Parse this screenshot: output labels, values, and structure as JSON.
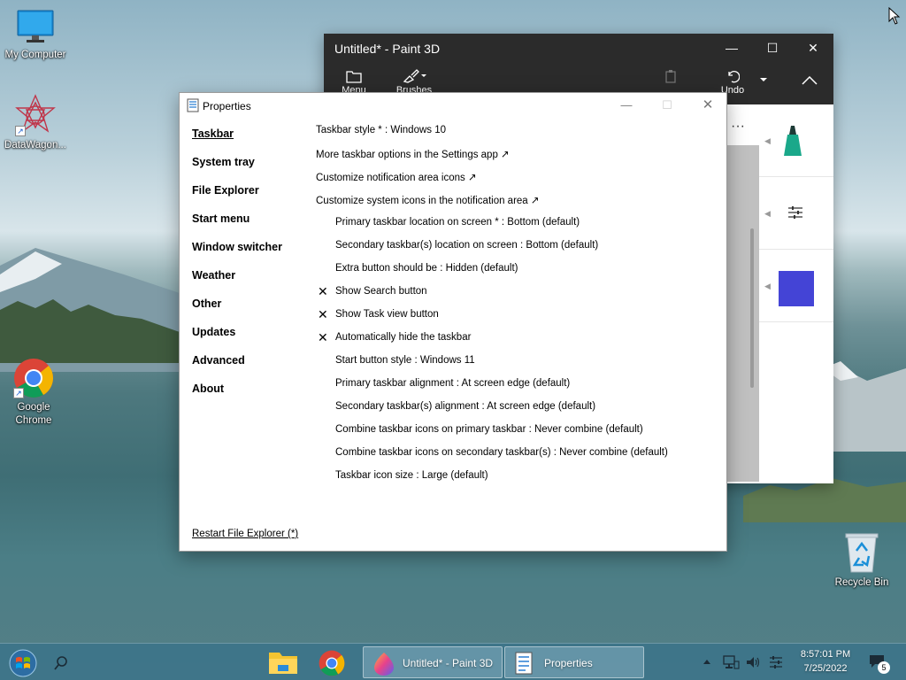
{
  "desktop": {
    "icons": [
      {
        "label": "My Computer"
      },
      {
        "label": "DataWagon..."
      },
      {
        "label": "Google Chrome"
      },
      {
        "label": "Recycle Bin"
      }
    ]
  },
  "paint": {
    "title": "Untitled* - Paint 3D",
    "toolbar": [
      {
        "label": "Menu",
        "icon": "folder-icon"
      },
      {
        "label": "Brushes",
        "icon": "brush-icon"
      },
      {
        "label": "",
        "icon": "paste-icon"
      },
      {
        "label": "Undo",
        "icon": "undo-icon"
      }
    ],
    "swatch_color": "#4444d6"
  },
  "properties": {
    "title": "Properties",
    "nav": [
      {
        "label": "Taskbar",
        "active": true
      },
      {
        "label": "System tray"
      },
      {
        "label": "File Explorer"
      },
      {
        "label": "Start menu"
      },
      {
        "label": "Window switcher"
      },
      {
        "label": "Weather"
      },
      {
        "label": "Other"
      },
      {
        "label": "Updates"
      },
      {
        "label": "Advanced"
      },
      {
        "label": "About"
      }
    ],
    "options": [
      {
        "text": "Taskbar style * : Windows 10",
        "indent": false,
        "checked": false
      },
      {
        "text": "More taskbar options in the Settings app ↗",
        "indent": false,
        "checked": false
      },
      {
        "text": "Customize notification area icons ↗",
        "indent": false,
        "checked": false
      },
      {
        "text": "Customize system icons in the notification area ↗",
        "indent": false,
        "checked": false
      },
      {
        "text": "Primary taskbar location on screen * : Bottom (default)",
        "indent": true,
        "checked": false
      },
      {
        "text": "Secondary taskbar(s) location on screen : Bottom (default)",
        "indent": true,
        "checked": false
      },
      {
        "text": "Extra button should be : Hidden (default)",
        "indent": true,
        "checked": false
      },
      {
        "text": "Show Search button",
        "indent": true,
        "checked": true
      },
      {
        "text": "Show Task view button",
        "indent": true,
        "checked": true
      },
      {
        "text": "Automatically hide the taskbar",
        "indent": true,
        "checked": true
      },
      {
        "text": "Start button style : Windows 11",
        "indent": true,
        "checked": false
      },
      {
        "text": "Primary taskbar alignment : At screen edge (default)",
        "indent": true,
        "checked": false
      },
      {
        "text": "Secondary taskbar(s) alignment : At screen edge (default)",
        "indent": true,
        "checked": false
      },
      {
        "text": "Combine taskbar icons on primary taskbar : Never combine (default)",
        "indent": true,
        "checked": false
      },
      {
        "text": "Combine taskbar icons on secondary taskbar(s) : Never combine (default)",
        "indent": true,
        "checked": false
      },
      {
        "text": "Taskbar icon size : Large (default)",
        "indent": true,
        "checked": false
      }
    ],
    "restart_link": "Restart File Explorer (*)"
  },
  "taskbar": {
    "tasks": [
      {
        "label": "Untitled* - Paint 3D"
      },
      {
        "label": "Properties"
      }
    ],
    "clock_time": "8:57:01 PM",
    "clock_date": "7/25/2022",
    "notification_count": "5"
  }
}
